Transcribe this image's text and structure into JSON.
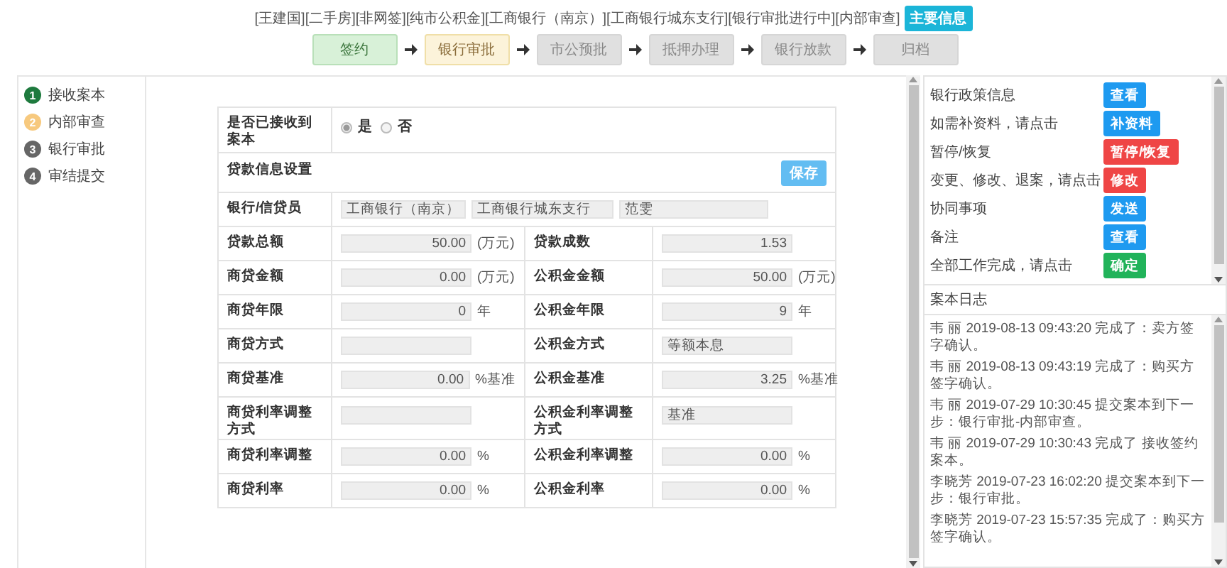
{
  "header": {
    "title": "[王建国][二手房][非网签][纯市公积金][工商银行（南京）][工商银行城东支行][银行审批进行中][内部审查]",
    "badge": "主要信息"
  },
  "flow": [
    {
      "label": "签约",
      "completed": true,
      "active": false
    },
    {
      "label": "银行审批",
      "completed": false,
      "active": true
    },
    {
      "label": "市公预批",
      "completed": false,
      "active": false
    },
    {
      "label": "抵押办理",
      "completed": false,
      "active": false
    },
    {
      "label": "银行放款",
      "completed": false,
      "active": false
    },
    {
      "label": "归档",
      "completed": false,
      "active": false
    }
  ],
  "sidebar": {
    "items": [
      {
        "number": "1",
        "label": "接收案本",
        "completed": true,
        "active": false
      },
      {
        "number": "2",
        "label": "内部审查",
        "completed": false,
        "active": true
      },
      {
        "number": "3",
        "label": "银行审批",
        "completed": false,
        "active": false
      },
      {
        "number": "4",
        "label": "审结提交",
        "completed": false,
        "active": false
      }
    ]
  },
  "form": {
    "rows": [
      {
        "kind": "radio",
        "label": "是否已接收到案本",
        "options": [
          {
            "label": "是",
            "selected": true
          },
          {
            "label": "否",
            "selected": false
          }
        ]
      },
      {
        "kind": "section",
        "label": "贷款信息设置",
        "button": "保存"
      },
      {
        "kind": "triple",
        "label": "银行/信贷员",
        "values": [
          "工商银行（南京）",
          "工商银行城东支行",
          "范雯"
        ]
      },
      {
        "kind": "pair",
        "cells": [
          {
            "label": "贷款总额",
            "value": "50.00",
            "unit": "(万元)",
            "numeric": true
          },
          {
            "label": "贷款成数",
            "value": "1.53",
            "numeric": true
          }
        ]
      },
      {
        "kind": "pair",
        "cells": [
          {
            "label": "商贷金额",
            "value": "0.00",
            "unit": "(万元)",
            "numeric": true
          },
          {
            "label": "公积金金额",
            "value": "50.00",
            "unit": "(万元)",
            "numeric": true
          }
        ]
      },
      {
        "kind": "pair",
        "cells": [
          {
            "label": "商贷年限",
            "value": "0",
            "unit": "年",
            "numeric": true
          },
          {
            "label": "公积金年限",
            "value": "9",
            "unit": "年",
            "numeric": true
          }
        ]
      },
      {
        "kind": "pair",
        "cells": [
          {
            "label": "商贷方式"
          },
          {
            "label": "公积金方式",
            "value": "等额本息",
            "numeric": false
          }
        ]
      },
      {
        "kind": "pair",
        "cells": [
          {
            "label": "商贷基准",
            "value": "0.00",
            "unit": "%基准",
            "numeric": true
          },
          {
            "label": "公积金基准",
            "value": "3.25",
            "unit": "%基准",
            "numeric": true
          }
        ]
      },
      {
        "kind": "pair",
        "cells": [
          {
            "label": "商贷利率调整方式"
          },
          {
            "label": "公积金利率调整方式",
            "value": "基准",
            "numeric": false
          }
        ]
      },
      {
        "kind": "pair",
        "cells": [
          {
            "label": "商贷利率调整",
            "value": "0.00",
            "unit": "%",
            "numeric": true
          },
          {
            "label": "公积金利率调整",
            "value": "0.00",
            "unit": "%",
            "numeric": true
          }
        ]
      },
      {
        "kind": "pair",
        "cells": [
          {
            "label": "商贷利率",
            "value": "0.00",
            "unit": "%",
            "numeric": true
          },
          {
            "label": "公积金利率",
            "value": "0.00",
            "unit": "%",
            "numeric": true
          }
        ]
      }
    ]
  },
  "actions": [
    {
      "label": "银行政策信息",
      "button": "查看",
      "color": "#1e9af0"
    },
    {
      "label": "如需补资料，请点击",
      "button": "补资料",
      "color": "#1e9af0"
    },
    {
      "label": "暂停/恢复",
      "button": "暂停/恢复",
      "color": "#ef4545"
    },
    {
      "label": "变更、修改、退案，请点击",
      "button": "修改",
      "color": "#ef4545"
    },
    {
      "label": "协同事项",
      "button": "发送",
      "color": "#1e9af0"
    },
    {
      "label": "备注",
      "button": "查看",
      "color": "#1e9af0"
    },
    {
      "label": "全部工作完成，请点击",
      "button": "确定",
      "color": "#21b35a"
    }
  ],
  "log": {
    "title": "案本日志",
    "entries": [
      "韦 丽 2019-08-13 09:43:20 完成了：卖方签字确认。",
      "韦 丽 2019-08-13 09:43:19 完成了：购买方签字确认。",
      "韦 丽 2019-07-29 10:30:45 提交案本到下一步：银行审批-内部审查。",
      "韦 丽 2019-07-29 10:30:43 完成了 接收签约案本。",
      "李晓芳 2019-07-23 16:02:20 提交案本到下一步：银行审批。",
      "李晓芳 2019-07-23 15:57:35 完成了：购买方签字确认。"
    ]
  }
}
